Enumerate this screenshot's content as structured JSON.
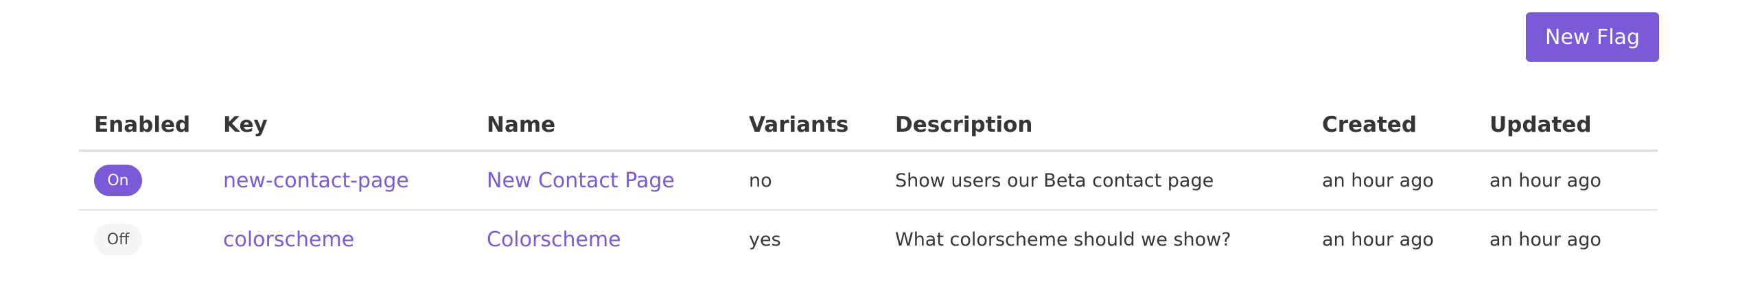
{
  "toolbar": {
    "new_flag_label": "New Flag"
  },
  "colors": {
    "accent": "#7b5ad8",
    "toggle_off_bg": "#f5f5f5",
    "text": "#363636",
    "divider": "#dbdbdb"
  },
  "table": {
    "headers": [
      "Enabled",
      "Key",
      "Name",
      "Variants",
      "Description",
      "Created",
      "Updated"
    ],
    "rows": [
      {
        "enabled": "On",
        "key": "new-contact-page",
        "name": "New Contact Page",
        "variants": "no",
        "description": "Show users our Beta contact page",
        "created": "an hour ago",
        "updated": "an hour ago"
      },
      {
        "enabled": "Off",
        "key": "colorscheme",
        "name": "Colorscheme",
        "variants": "yes",
        "description": "What colorscheme should we show?",
        "created": "an hour ago",
        "updated": "an hour ago"
      }
    ]
  }
}
